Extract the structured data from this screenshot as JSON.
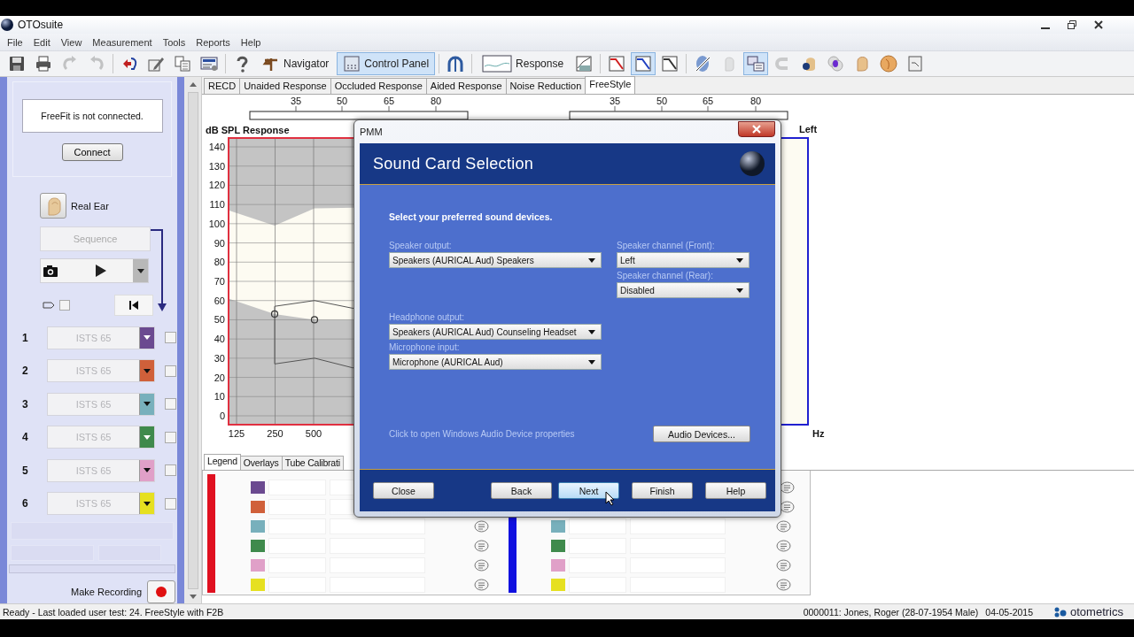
{
  "window": {
    "title": "OTOsuite"
  },
  "menu": [
    "File",
    "Edit",
    "View",
    "Measurement",
    "Tools",
    "Reports",
    "Help"
  ],
  "toolbar": [
    {
      "kind": "icon",
      "selected": false,
      "disabled": false
    },
    {
      "kind": "icon",
      "selected": false,
      "disabled": false
    },
    {
      "kind": "icon",
      "selected": false,
      "disabled": true
    },
    {
      "kind": "icon",
      "selected": false,
      "disabled": true
    },
    {
      "kind": "separator"
    },
    {
      "kind": "icon",
      "selected": false,
      "disabled": false
    },
    {
      "kind": "icon",
      "selected": false,
      "disabled": false
    },
    {
      "kind": "icon",
      "selected": false,
      "disabled": false
    },
    {
      "kind": "icon",
      "selected": false,
      "disabled": false
    },
    {
      "kind": "separator"
    },
    {
      "kind": "icon",
      "selected": false,
      "disabled": false
    },
    {
      "kind": "labeled",
      "label": "Navigator",
      "selected": false
    },
    {
      "kind": "labeled",
      "label": "Control Panel",
      "selected": true
    },
    {
      "kind": "separator"
    },
    {
      "kind": "icon",
      "selected": false,
      "disabled": false
    },
    {
      "kind": "separator"
    },
    {
      "kind": "labeled",
      "label": "Response",
      "selected": false
    },
    {
      "kind": "icon",
      "selected": false,
      "disabled": false
    },
    {
      "kind": "separator"
    },
    {
      "kind": "icon",
      "selected": false,
      "disabled": false
    },
    {
      "kind": "icon",
      "selected": true,
      "disabled": false
    },
    {
      "kind": "icon",
      "selected": false,
      "disabled": false
    },
    {
      "kind": "separator"
    },
    {
      "kind": "icon",
      "selected": false,
      "disabled": false
    },
    {
      "kind": "icon",
      "selected": false,
      "disabled": true
    },
    {
      "kind": "icon",
      "selected": true,
      "disabled": false
    },
    {
      "kind": "icon",
      "selected": false,
      "disabled": true
    },
    {
      "kind": "icon",
      "selected": false,
      "disabled": false
    },
    {
      "kind": "icon",
      "selected": false,
      "disabled": false
    },
    {
      "kind": "icon",
      "selected": false,
      "disabled": false
    },
    {
      "kind": "icon",
      "selected": false,
      "disabled": false
    },
    {
      "kind": "icon",
      "selected": false,
      "disabled": false
    }
  ],
  "tabs": [
    {
      "label": "RECD",
      "selected": false
    },
    {
      "label": "Unaided Response",
      "selected": false
    },
    {
      "label": "Occluded Response",
      "selected": false
    },
    {
      "label": "Aided Response",
      "selected": false
    },
    {
      "label": "Noise Reduction",
      "selected": false
    },
    {
      "label": "FreeStyle",
      "selected": true
    }
  ],
  "left_panel": {
    "freefit": {
      "message": "FreeFit is not connected.",
      "button": "Connect"
    },
    "real_ear": "Real Ear",
    "sequence": {
      "label": "Sequence",
      "disabled": true
    },
    "snapshot_option": {
      "checked": false
    },
    "channels": [
      {
        "number": "1",
        "signal": "ISTS 65",
        "color": "#6b4a90",
        "checked": false
      },
      {
        "number": "2",
        "signal": "ISTS 65",
        "color": "#d0603a",
        "checked": false
      },
      {
        "number": "3",
        "signal": "ISTS 65",
        "color": "#78b0bc",
        "checked": false
      },
      {
        "number": "4",
        "signal": "ISTS 65",
        "color": "#3f8a4c",
        "checked": false
      },
      {
        "number": "5",
        "signal": "ISTS 65",
        "color": "#e0a0c8",
        "checked": false
      },
      {
        "number": "6",
        "signal": "ISTS 65",
        "color": "#e6e020",
        "checked": false
      }
    ],
    "make_recording": "Make Recording"
  },
  "level_scales": [
    [
      "35",
      "50",
      "65",
      "80"
    ],
    [
      "35",
      "50",
      "65",
      "80"
    ]
  ],
  "response_chart": {
    "title": "dB SPL Response",
    "y_labels": [
      "140",
      "130",
      "120",
      "110",
      "100",
      "90",
      "80",
      "70",
      "60",
      "50",
      "40",
      "30",
      "20",
      "10",
      "0"
    ],
    "x_labels": [
      "125",
      "250",
      "500"
    ]
  },
  "left_chart": {
    "ear": "Left",
    "x_unit": "Hz"
  },
  "bottom_tabs": [
    {
      "label": "Legend",
      "selected": true
    },
    {
      "label": "Overlays",
      "selected": false
    },
    {
      "label": "Tube Calibrati",
      "selected": false
    }
  ],
  "legends": [
    {
      "color": "#e01020",
      "rows": [
        {
          "color": "#6b4a90",
          "note": false
        },
        {
          "color": "#d0603a",
          "note": false
        },
        {
          "color": "#78b0bc",
          "note": true
        },
        {
          "color": "#3f8a4c",
          "note": true
        },
        {
          "color": "#e0a0c8",
          "note": true
        },
        {
          "color": "#e6e020",
          "note": true
        }
      ]
    },
    {
      "color": "#1010e0",
      "rows": [
        {
          "note": true
        },
        {
          "note": true
        },
        {
          "color": "#78b0bc",
          "note": true
        },
        {
          "color": "#3f8a4c",
          "note": true
        },
        {
          "color": "#e0a0c8",
          "note": true
        },
        {
          "color": "#e6e020",
          "note": true
        }
      ]
    }
  ],
  "dialog": {
    "title": "PMM",
    "heading": "Sound Card Selection",
    "instruction": "Select your preferred sound devices.",
    "left_fields": [
      {
        "label": "Speaker output:",
        "value": "Speakers (AURICAL Aud) Speakers"
      },
      {
        "label": "Headphone output:",
        "value": "Speakers (AURICAL Aud) Counseling Headset"
      },
      {
        "label": "Microphone input:",
        "value": "Microphone (AURICAL Aud)"
      }
    ],
    "right_fields": [
      {
        "label": "Speaker channel (Front):",
        "value": "Left"
      },
      {
        "label": "Speaker channel (Rear):",
        "value": "Disabled"
      }
    ],
    "link": "Click to open Windows Audio Device properties",
    "audio_button": "Audio Devices...",
    "buttons": [
      {
        "label": "Close",
        "hovered": false
      },
      {
        "label": "Back",
        "hovered": false
      },
      {
        "label": "Next",
        "hovered": true
      },
      {
        "label": "Finish",
        "hovered": false
      },
      {
        "label": "Help",
        "hovered": false
      }
    ]
  },
  "status_bar": {
    "message": "Ready - Last loaded user test: 24. FreeStyle with F2B",
    "patient": "0000011: Jones, Roger (28-07-1954 Male)",
    "date": "04-05-2015",
    "brand": "otometrics"
  }
}
